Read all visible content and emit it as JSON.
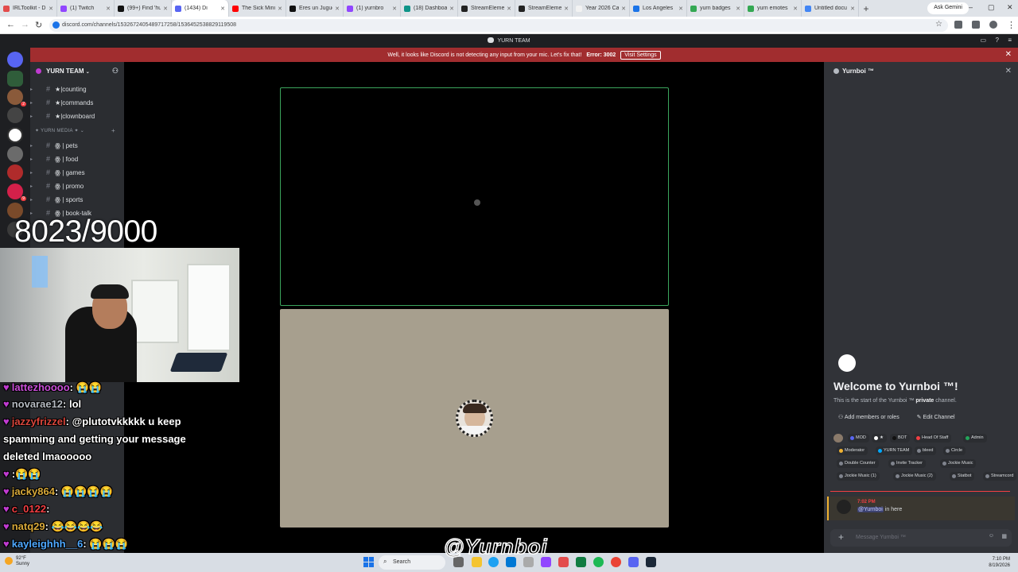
{
  "browser": {
    "tabs": [
      {
        "label": "IRLToolkit - D",
        "color": "#e34c4c"
      },
      {
        "label": "(1) Twitch",
        "color": "#9146ff"
      },
      {
        "label": "(99+) Find 'hu",
        "color": "#111111"
      },
      {
        "label": "(1434) Di",
        "color": "#5865f2",
        "active": true
      },
      {
        "label": "The Sick Minu",
        "color": "#ff0000"
      },
      {
        "label": "Eres un Jugue",
        "color": "#111111"
      },
      {
        "label": "(1) yurnbro",
        "color": "#9146ff"
      },
      {
        "label": "(18) Dashboa",
        "color": "#0d9488"
      },
      {
        "label": "StreamEleme",
        "color": "#222222"
      },
      {
        "label": "StreamEleme",
        "color": "#222222"
      },
      {
        "label": "Year 2026 Ca",
        "color": "#f2f2f2"
      },
      {
        "label": "Los Angeles",
        "color": "#1a73e8"
      },
      {
        "label": "yurn badges",
        "color": "#34a853"
      },
      {
        "label": "yurn emotes",
        "color": "#34a853"
      },
      {
        "label": "Untitled docu",
        "color": "#4285f4"
      }
    ],
    "new_tab": "+",
    "gemini_label": "Ask Gemini",
    "url": "discord.com/channels/1532672405489717258/1536452538829119508"
  },
  "discord": {
    "title": "YURN TEAM",
    "banner": {
      "text": "Well, it looks like Discord is not detecting any input from your mic. Let's fix that!",
      "error": "Error: 3002",
      "button": "Visit Settings"
    },
    "server_name": "YURN TEAM",
    "channels_top": [
      "★|counting",
      "★|commands",
      "★|clownboard"
    ],
    "category": "✦ YURN MEDIA ✦",
    "channels_media": [
      "ꙮ | pets",
      "ꙮ | food",
      "ꙮ | games",
      "ꙮ | promo",
      "ꙮ | sports",
      "ꙮ | book-talk"
    ],
    "right_panel": {
      "channel": "Yurnboi ™",
      "welcome": "Welcome to Yurnboi ™!",
      "start_prefix": "This is the start of the Yurnboi ™",
      "start_bold": "private",
      "start_suffix": "channel.",
      "add_members": "Add members or roles",
      "edit_channel": "Edit Channel",
      "roles_row1": [
        {
          "label": "MOD",
          "color": "#5865f2"
        },
        {
          "label": "★",
          "color": "#ffffff"
        },
        {
          "label": "BOT",
          "color": "#111111"
        },
        {
          "label": "Head Of Staff",
          "color": "#f23f43"
        },
        {
          "label": "Admin",
          "color": "#23a55a"
        }
      ],
      "roles_row2": [
        {
          "label": "Moderator",
          "color": "#f0b232"
        },
        {
          "label": "YURN TEAM",
          "color": "#00a8fc"
        },
        {
          "label": "bleed",
          "color": "#80848e"
        },
        {
          "label": "Circle",
          "color": "#80848e"
        }
      ],
      "roles_row3": [
        {
          "label": "Double Counter",
          "color": "#80848e"
        },
        {
          "label": "Invite Tracker",
          "color": "#80848e"
        },
        {
          "label": "Jockie Music",
          "color": "#80848e"
        }
      ],
      "roles_row4": [
        {
          "label": "Jockie Music (1)",
          "color": "#80848e"
        },
        {
          "label": "Jockie Music (2)",
          "color": "#80848e"
        },
        {
          "label": "Statbot",
          "color": "#80848e"
        },
        {
          "label": "Streamcord",
          "color": "#80848e"
        }
      ],
      "message_time": "7:02 PM",
      "message_mention": "@Yurnboi",
      "message_text": "in here",
      "composer_placeholder": "Message Yurnboi ™"
    }
  },
  "stream": {
    "counter": "8023/9000",
    "chat": [
      {
        "name": "lattezhoooo",
        "text": ": 😭😭",
        "color": "#c94fd8"
      },
      {
        "name": "novarae12",
        "text": ": lol",
        "color": "#b5bac1"
      },
      {
        "name": "jazzyfrizzel",
        "text": ": @plutotvkkkkk u keep",
        "color": "#d9463c"
      },
      {
        "name": "",
        "text": "spamming and getting your message",
        "color": "#ffffff"
      },
      {
        "name": "",
        "text": "deleted lmaooooo",
        "color": "#ffffff"
      },
      {
        "name": "",
        "text": ":😭😭",
        "color": "#e05ab8"
      },
      {
        "name": "jacky864",
        "text": ": 😭😭😭😭",
        "color": "#d8a93a"
      },
      {
        "name": "c_0122",
        "text": ":",
        "color": "#f23f43"
      },
      {
        "name": "natq29",
        "text": ": 😂😂😂😂",
        "color": "#d8a93a"
      },
      {
        "name": "kayleighhh__6",
        "text": ": 😭😭😭",
        "color": "#4ea8ff"
      }
    ],
    "watermark": "@Yurnboi"
  },
  "taskbar": {
    "weather_temp": "92°F",
    "weather_desc": "Sunny",
    "search": "Search",
    "time": "7:10 PM",
    "date": "8/19/2026"
  }
}
